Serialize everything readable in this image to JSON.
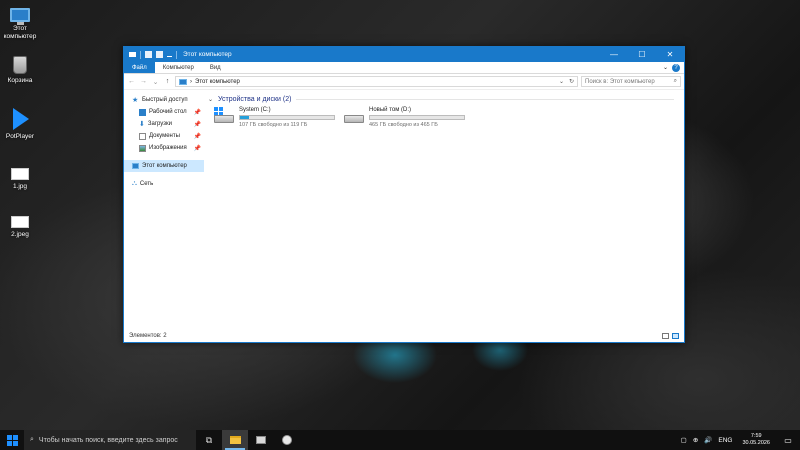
{
  "desktop": {
    "icons": [
      {
        "label": "Этот компьютер",
        "icon": "this-pc-icon"
      },
      {
        "label": "Корзина",
        "icon": "recycle-bin-icon"
      },
      {
        "label": "PotPlayer",
        "icon": "potplayer-icon"
      },
      {
        "label": "1.jpg",
        "icon": "image-file-icon"
      },
      {
        "label": "2.jpeg",
        "icon": "image-file-icon"
      }
    ]
  },
  "window": {
    "title": "Этот компьютер",
    "controls": {
      "minimize": "—",
      "maximize": "☐",
      "close": "✕"
    },
    "ribbon_tabs": [
      "Файл",
      "Компьютер",
      "Вид"
    ],
    "ribbon_expand": "⌄",
    "help": "?",
    "address": {
      "path": "Этот компьютер",
      "separator": "›",
      "dropdown": "⌄",
      "refresh": "↻"
    },
    "search": {
      "placeholder": "Поиск в: Этот компьютер",
      "icon": "⌕"
    },
    "nav": {
      "back": "←",
      "forward": "→",
      "recent": "⌄",
      "up": "↑"
    },
    "navpane": {
      "quick_access": "Быстрый доступ",
      "items": [
        {
          "label": "Рабочий стол",
          "pin": "📌"
        },
        {
          "label": "Загрузки",
          "pin": "📌"
        },
        {
          "label": "Документы",
          "pin": "📌"
        },
        {
          "label": "Изображения",
          "pin": "📌"
        }
      ],
      "this_pc": "Этот компьютер",
      "network": "Сеть"
    },
    "group": {
      "title": "Устройства и диски (2)",
      "chevron": "⌄"
    },
    "drives": [
      {
        "name": "System (C:)",
        "free": "107 ГБ свободно из 119 ГБ",
        "used_fraction": 0.1
      },
      {
        "name": "Новый том (D:)",
        "free": "465 ГБ свободно из 465 ГБ",
        "used_fraction": 0.0
      }
    ],
    "status": "Элементов: 2"
  },
  "taskbar": {
    "search_placeholder": "Чтобы начать поиск, введите здесь запрос",
    "search_icon": "⌕",
    "task_view": "⧉",
    "tray": {
      "language": "ENG",
      "time": "7:59",
      "date": "30.05.2026",
      "notification": "▭"
    }
  },
  "colors": {
    "accent": "#1979ca",
    "drive_bar": "#26a0da",
    "group_header": "#1e3287"
  }
}
